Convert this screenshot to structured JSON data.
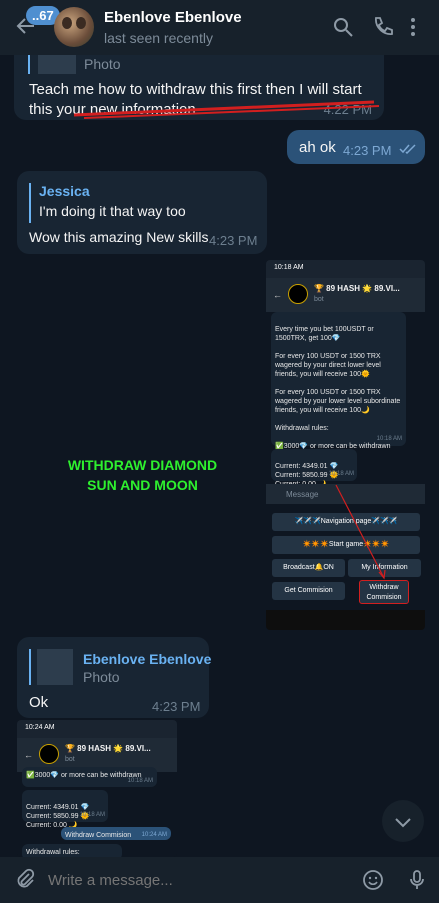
{
  "header": {
    "unread_count": "..67",
    "title": "Ebenlove Ebenlove",
    "status": "last seen recently",
    "icons": [
      "back-arrow-icon",
      "search-icon",
      "phone-icon",
      "more-icon"
    ]
  },
  "messages": {
    "m1": {
      "reply_subtitle": "Photo",
      "text": "Teach me how to withdraw this first then I will start this your new information",
      "time": "4:22 PM"
    },
    "m2": {
      "text": "ah ok",
      "time": "4:23 PM"
    },
    "m3": {
      "reply_name": "Jessica",
      "reply_text": "I'm doing it that way too",
      "text": "Wow this amazing New skills",
      "time": "4:23 PM"
    },
    "m4": {
      "overlay_text": "WITHDRAW DIAMOND SUN AND MOON",
      "phone": {
        "status_time": "10:18 AM",
        "bot_title": "🏆 89 HASH 🌟 89.VI...",
        "bot_sub": "bot",
        "msg1": "Every time you bet 100USDT or 1500TRX, get 100💎\n\nFor every 100 USDT or 1500 TRX wagered by your direct lower level friends, you will receive 100🌞\n\nFor every 100 USDT or 1500 TRX wagered by your lower level subordinate friends, you will receive 100🌙\n\nWithdrawal rules:\n\n✅3000💎 or more can be withdrawn",
        "msg1_time": "10:18 AM",
        "msg2": "Current: 4349.01 💎\nCurrent: 5850.99 🌞\nCurrent: 0.00 🌙",
        "msg2_time": "10:18 AM",
        "input_placeholder": "Message",
        "buttons": {
          "nav": "✈️✈️✈️Navigation page✈️✈️✈️",
          "start": "✴️✴️✴️Start game✴️✴️✴️",
          "broadcast": "Broadcast🔔ON",
          "info": "My Information",
          "commission": "Get Commision",
          "withdraw": "Withdraw Commision"
        }
      }
    },
    "m5": {
      "reply_name": "Ebenlove Ebenlove",
      "reply_subtitle": "Photo",
      "text": "Ok",
      "time": "4:23 PM"
    },
    "m6": {
      "phone": {
        "status_time": "10:24 AM",
        "bot_title": "🏆 89 HASH 🌟 89.VI...",
        "bot_sub": "bot",
        "msg1": "✅3000💎 or more can be withdrawn",
        "msg1_time": "10:18 AM",
        "msg2": "Current: 4349.01 💎\nCurrent: 5850.99 🌞\nCurrent: 0.00 🌙",
        "msg2_time": "10:18 AM",
        "out_msg": "Withdraw Commision",
        "out_time": "10:24 AM",
        "msg3": "Withdrawal rules:"
      }
    }
  },
  "composer": {
    "placeholder": "Write a message..."
  }
}
